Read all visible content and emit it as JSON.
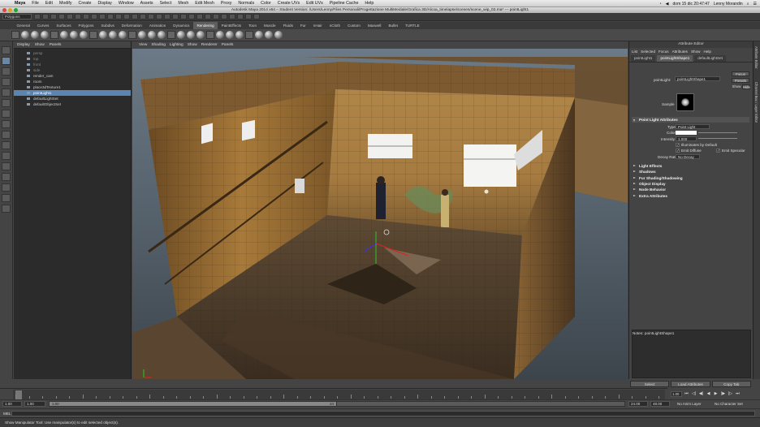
{
  "mac_menubar": {
    "app": "Maya",
    "items": [
      "File",
      "Edit",
      "Modify",
      "Create",
      "Display",
      "Window",
      "Assets",
      "Select",
      "Mesh",
      "Edit Mesh",
      "Proxy",
      "Normals",
      "Color",
      "Create UVs",
      "Edit UVs",
      "Pipeline Cache",
      "Help"
    ],
    "clock": "dom 15 dic  20:47:47",
    "user": "Lenny Morandin"
  },
  "window_title": "Autodesk Maya 2014 x64 – Student Version: /Users/Lenny/Files Personali/Progettazione MultiMediale/Grafica 3D/Alcoa_timelapse/scenes/scene_wip_02.ma*  ---  pointLight1",
  "status_line": {
    "menuset": "Polygons"
  },
  "shelf": {
    "tabs": [
      "General",
      "Curves",
      "Surfaces",
      "Polygons",
      "Subdivs",
      "Deformation",
      "Animation",
      "Dynamics",
      "Rendering",
      "PaintEffects",
      "Toon",
      "Muscle",
      "Fluids",
      "Fur",
      "nHair",
      "nCloth",
      "Custom",
      "Maxwell",
      "Bullet",
      "TURTLE"
    ],
    "active_tab": "Rendering"
  },
  "outliner": {
    "menu": [
      "Display",
      "Show",
      "Panels"
    ],
    "items": [
      {
        "label": "persp",
        "hidden": true
      },
      {
        "label": "top",
        "hidden": true
      },
      {
        "label": "front",
        "hidden": true
      },
      {
        "label": "side",
        "hidden": true
      },
      {
        "label": "render_cam",
        "hidden": false
      },
      {
        "label": "room",
        "hidden": false
      },
      {
        "label": "place3dTexture1",
        "hidden": false
      },
      {
        "label": "pointLight1",
        "hidden": false,
        "selected": true
      },
      {
        "label": "defaultLightSet",
        "hidden": false
      },
      {
        "label": "defaultObjectSet",
        "hidden": false
      }
    ]
  },
  "viewport": {
    "menu": [
      "View",
      "Shading",
      "Lighting",
      "Show",
      "Renderer",
      "Panels"
    ]
  },
  "attribute_editor": {
    "title": "Attribute Editor",
    "menu": [
      "List",
      "Selected",
      "Focus",
      "Attributes",
      "Show",
      "Help"
    ],
    "tabs": [
      "pointLight1",
      "pointLightShape1",
      "defaultLightSet"
    ],
    "active_tab": "pointLightShape1",
    "node_type_label": "pointLight:",
    "node_name": "pointLightShape1",
    "focus_button": "Focus",
    "presets_button": "Presets",
    "show_label": "Show",
    "hide_label": "Hide",
    "sample_label": "Sample",
    "section_open": "Point Light Attributes",
    "type_label": "Type",
    "type_value": "Point Light",
    "color_label": "Color",
    "intensity_label": "Intensity",
    "intensity_value": "1.000",
    "illuminates_label": "Illuminates by Default",
    "emit_diffuse_label": "Emit Diffuse",
    "emit_specular_label": "Emit Specular",
    "decay_label": "Decay Rate",
    "decay_value": "No Decay",
    "collapsed_sections": [
      "Light Effects",
      "Shadows",
      "Fur Shading/Shadowing",
      "Object Display",
      "Node Behavior",
      "Extra Attributes"
    ],
    "notes_label": "Notes:  pointLightShape1",
    "buttons": [
      "Select",
      "Load Attributes",
      "Copy Tab"
    ]
  },
  "right_strip": [
    "Attribute Editor",
    "Channel Box / Layer Editor"
  ],
  "timeline": {
    "start": "1.00",
    "current_frame": "1.00",
    "playback_start": "1.00",
    "playback_start_inner": "1.00",
    "range_marker": "24",
    "playback_end_inner": "24.00",
    "playback_end": "48.00",
    "anim_layer": "No Anim Layer",
    "char_set": "No Character Set"
  },
  "mel_label": "MEL",
  "help_line": "Show Manipulator Tool: Use manipulator(s) to edit selected object(s).",
  "colors": {
    "selection": "#5c84b1",
    "active_tab": "#5e5e5e",
    "bg": "#444444"
  }
}
